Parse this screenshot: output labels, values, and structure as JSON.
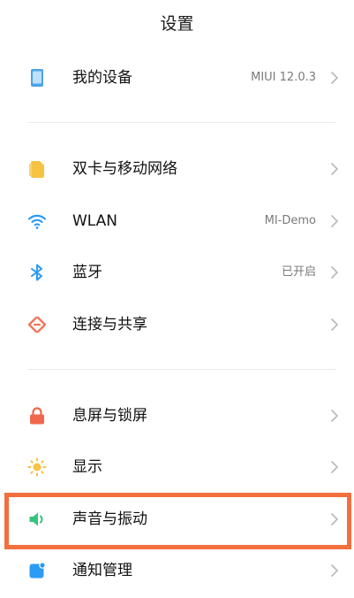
{
  "header": {
    "title": "设置"
  },
  "items": [
    {
      "label": "我的设备",
      "value": "MIUI 12.0.3",
      "icon": "device-icon",
      "color": "#4aa3e8"
    },
    {
      "label": "双卡与移动网络",
      "value": "",
      "icon": "sim-card-icon",
      "color": "#f6c343"
    },
    {
      "label": "WLAN",
      "value": "MI-Demo",
      "icon": "wifi-icon",
      "color": "#2b9bf4"
    },
    {
      "label": "蓝牙",
      "value": "已开启",
      "icon": "bluetooth-icon",
      "color": "#2b9bf4"
    },
    {
      "label": "连接与共享",
      "value": "",
      "icon": "connection-sharing-icon",
      "color": "#f0775b"
    },
    {
      "label": "息屏与锁屏",
      "value": "",
      "icon": "lock-icon",
      "color": "#f0674d"
    },
    {
      "label": "显示",
      "value": "",
      "icon": "brightness-icon",
      "color": "#f6c343"
    },
    {
      "label": "声音与振动",
      "value": "",
      "icon": "speaker-icon",
      "color": "#36c47c"
    },
    {
      "label": "通知管理",
      "value": "",
      "icon": "notification-icon",
      "color": "#2b9bf4"
    }
  ],
  "colors": {
    "highlight_border": "#f26f3e",
    "chevron": "#b8b8b8",
    "secondary_text": "#7a7a7a"
  }
}
